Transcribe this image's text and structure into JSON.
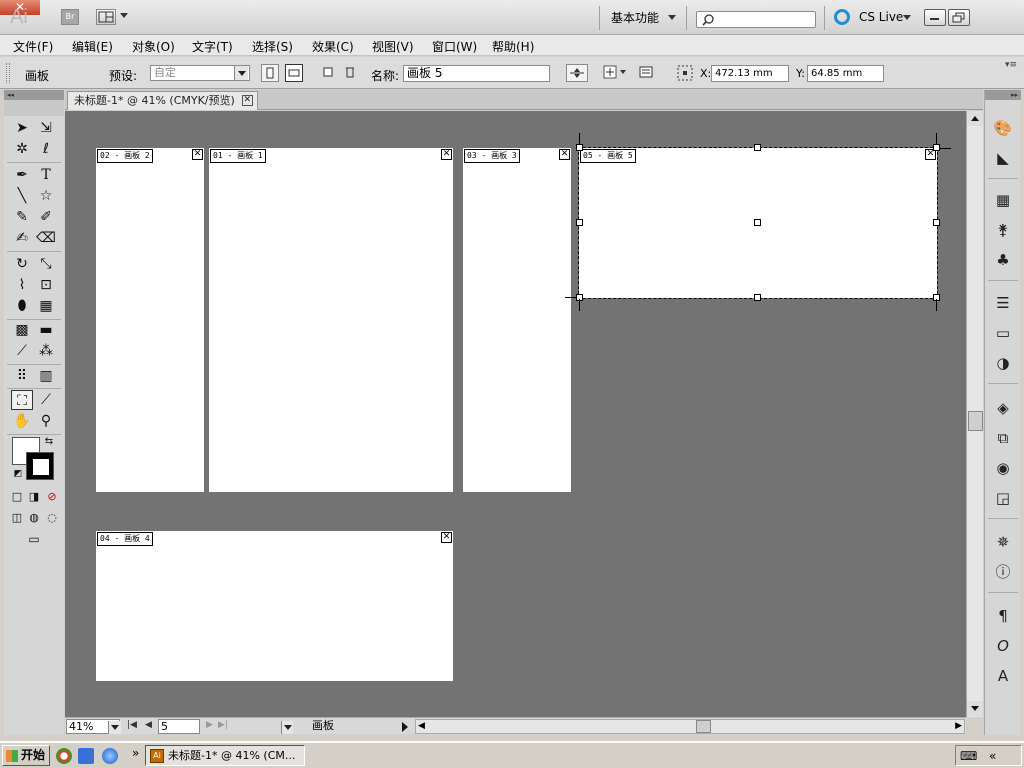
{
  "window": {
    "app_logo": "Ai",
    "bridge_label": "Br",
    "workspace": "基本功能",
    "search_placeholder": "",
    "cslive": "CS Live",
    "close_label": "✕"
  },
  "menu": [
    "文件(F)",
    "编辑(E)",
    "对象(O)",
    "文字(T)",
    "选择(S)",
    "效果(C)",
    "视图(V)",
    "窗口(W)",
    "帮助(H)"
  ],
  "controlbar": {
    "artboard_label": "画板",
    "preset_label": "预设:",
    "preset_value": "自定",
    "name_label": "名称:",
    "name_value": "画板 5",
    "x_label": "X:",
    "x_value": "472.13 mm",
    "y_label": "Y:",
    "y_value": "64.85 mm"
  },
  "document": {
    "tab_title": "未标题-1* @ 41% (CMYK/预览)",
    "tab_close": "✕"
  },
  "artboards": [
    {
      "label": "02 - 画板 2"
    },
    {
      "label": "01 - 画板 1"
    },
    {
      "label": "03 - 画板 3"
    },
    {
      "label": "05 - 画板 5",
      "selected": true
    },
    {
      "label": "04 - 画板 4"
    }
  ],
  "statusbar": {
    "zoom": "41%",
    "page": "5",
    "current_tool": "画板"
  },
  "taskbar": {
    "start": "开始",
    "task_title": "未标题-1* @ 41% (CM...",
    "more": "»"
  },
  "icons": {
    "search": "search-icon",
    "cslive": "cslive-icon",
    "close": "close-icon"
  },
  "colors": {
    "canvas": "#737373",
    "artboard": "#ffffff",
    "cslive_accent": "#1f8fd6",
    "close_button": "#c3432a"
  }
}
